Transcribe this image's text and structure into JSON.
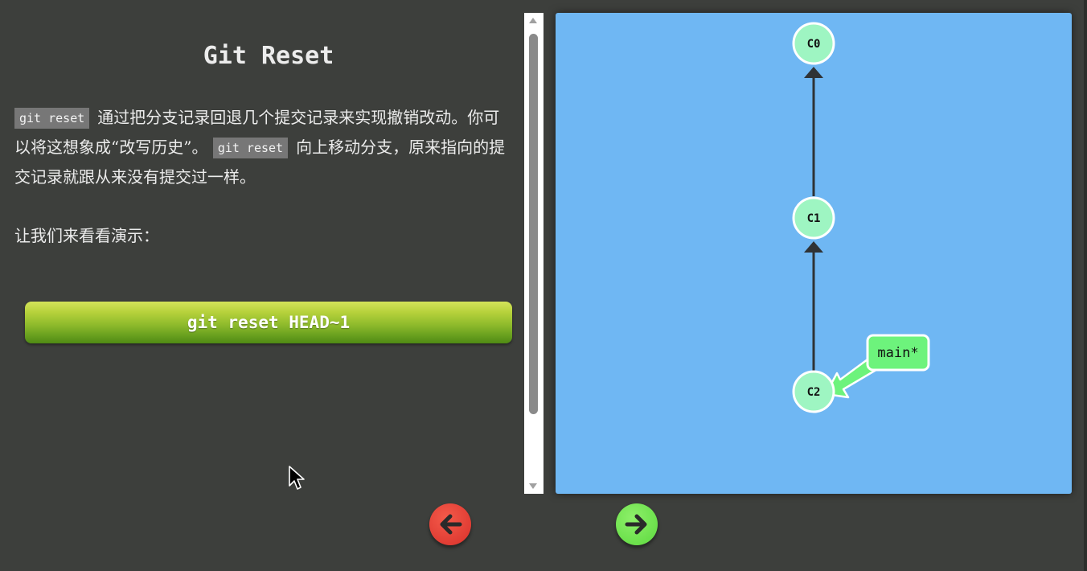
{
  "lesson": {
    "title": "Git Reset",
    "code_term": "git reset",
    "text_part1": "通过把分支记录回退几个提交记录来实现撤销改动。你可以将这想象成“改写历史”。",
    "text_part2": "向上移动分支，原来指向的提交记录就跟从来没有提交过一样。",
    "text_demo": "让我们来看看演示：",
    "command_button": "git reset HEAD~1"
  },
  "graph": {
    "commits": [
      "C0",
      "C1",
      "C2"
    ],
    "branch_label": "main*",
    "node_color": "#9ef5c2",
    "branch_color": "#6df37c",
    "background": "#6fb7f3"
  },
  "nav": {
    "back_color": "#e0392f",
    "forward_color": "#6de24f"
  }
}
